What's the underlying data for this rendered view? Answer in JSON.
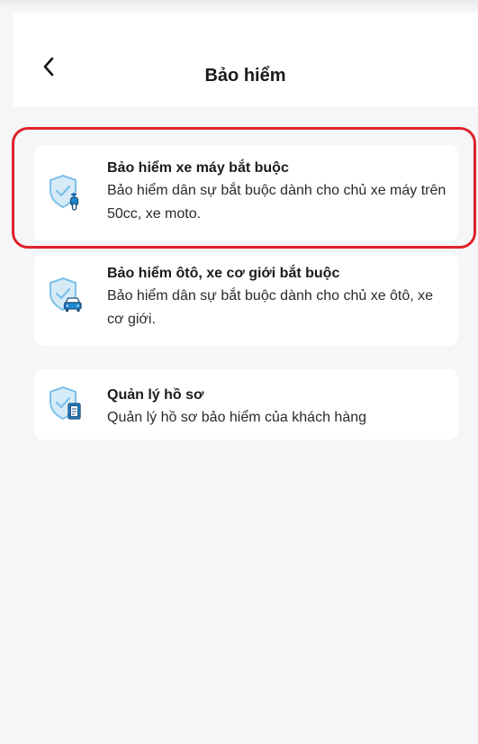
{
  "header": {
    "title": "Bảo hiểm",
    "back_icon": "chevron-left-icon"
  },
  "cards": [
    {
      "title": "Bảo hiểm xe máy bắt buộc",
      "description": "Bảo hiểm dân sự bắt buộc dành cho chủ xe máy trên 50cc, xe moto.",
      "icon": "shield-motorbike-icon"
    },
    {
      "title": "Bảo hiểm ôtô, xe cơ giới bắt buộc",
      "description": "Bảo hiểm dân sự bắt buộc dành cho chủ xe ôtô, xe cơ giới.",
      "icon": "shield-car-icon"
    },
    {
      "title": "Quản lý hồ sơ",
      "description": "Quản lý hồ sơ bảo hiểm của khách hàng",
      "icon": "shield-document-icon"
    }
  ],
  "colors": {
    "highlight": "#e0222b",
    "shield_fill": "#d6ebf8",
    "shield_stroke": "#7cc0ea",
    "icon_accent": "#1e88d2"
  }
}
